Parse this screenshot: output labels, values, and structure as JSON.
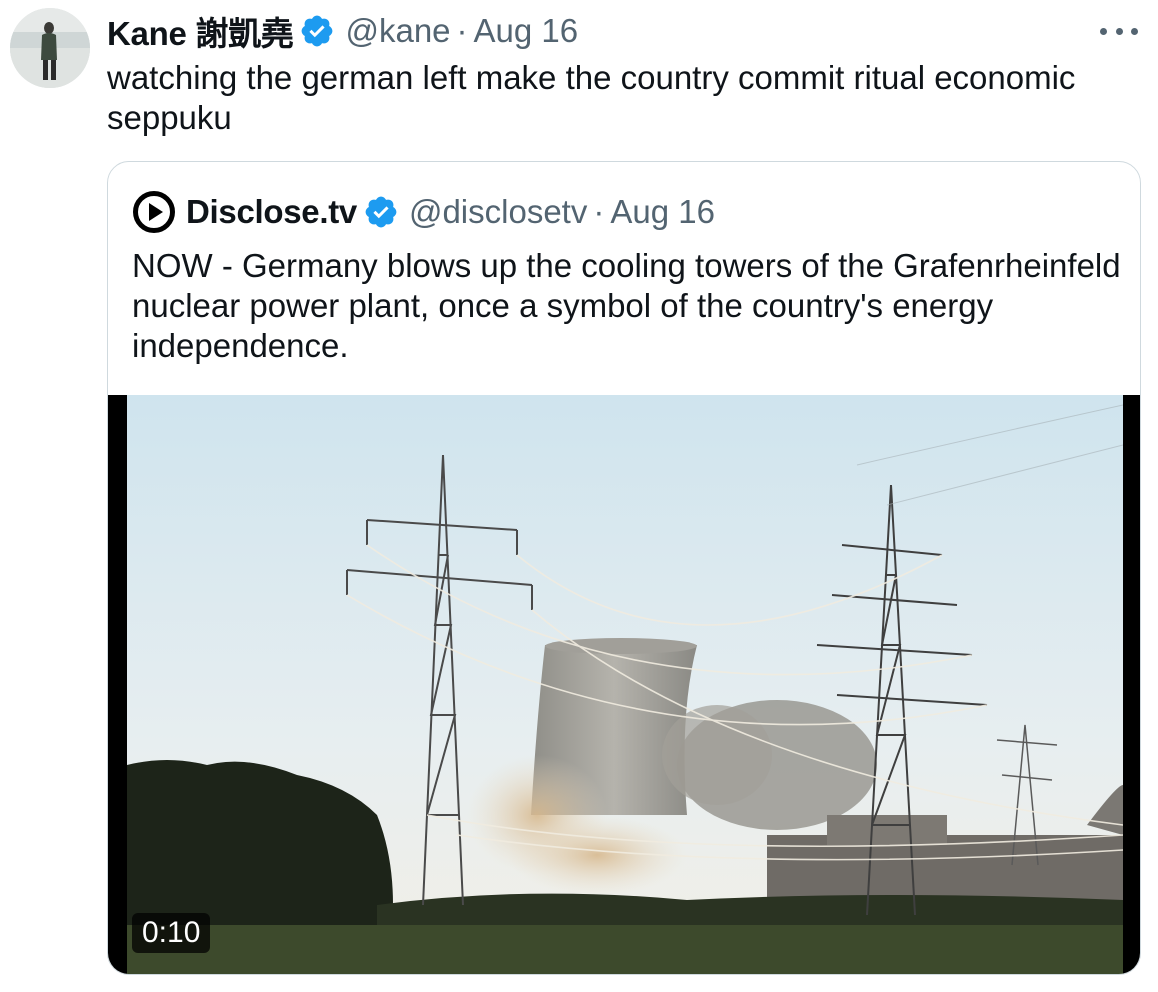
{
  "tweet": {
    "author": {
      "display_name": "Kane 謝凱堯",
      "handle": "@kane",
      "avatar_icon": "person-standing-photo"
    },
    "separator": "·",
    "date": "Aug 16",
    "text": "watching the german left make the country commit ritual economic seppuku",
    "more_icon": "ellipsis-icon"
  },
  "quote": {
    "author": {
      "display_name": "Disclose.tv",
      "handle": "@disclosetv",
      "avatar_icon": "play-circle-logo"
    },
    "separator": "·",
    "date": "Aug 16",
    "text": "NOW - Germany blows up the cooling towers of the Grafenrheinfeld nuclear power plant, once a symbol of the country's energy independence.",
    "media": {
      "type": "video",
      "duration": "0:10",
      "scene": "cooling-tower-demolition"
    }
  },
  "colors": {
    "verified_badge": "#1d9bf0",
    "secondary_text": "#536471",
    "border": "#cfd9de",
    "primary_text": "#0f1419"
  }
}
